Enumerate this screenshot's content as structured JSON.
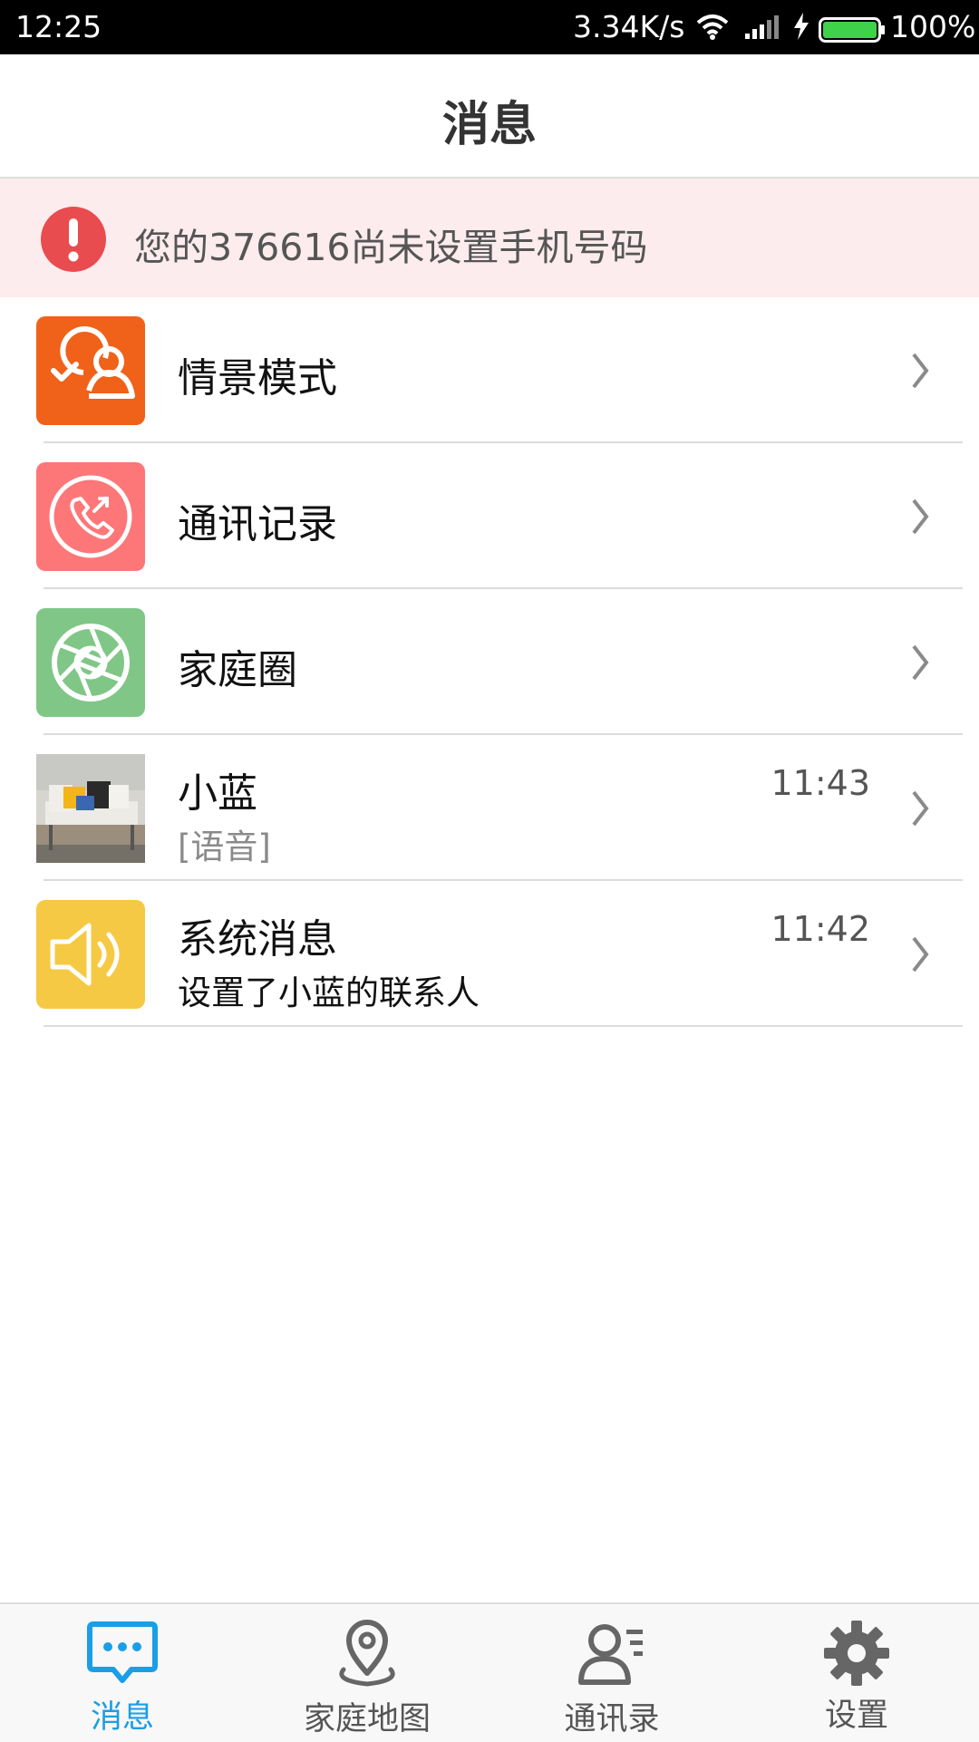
{
  "status_bar": {
    "time": "12:25",
    "speed": "3.34K/s",
    "battery": "100%",
    "battery_level": 1.0
  },
  "header": {
    "title": "消息"
  },
  "alert": {
    "text": "您的376616尚未设置手机号码",
    "icon": "exclamation-icon",
    "color": "#e84c4f"
  },
  "list": {
    "items": [
      {
        "title": "情景模式",
        "icon": "scene-mode-icon",
        "icon_color": "#f0611a"
      },
      {
        "title": "通讯记录",
        "icon": "phone-icon",
        "icon_color": "#fd7779"
      },
      {
        "title": "家庭圈",
        "icon": "aperture-icon",
        "icon_color": "#80c787"
      },
      {
        "title": "小蓝",
        "subtitle": "[语音]",
        "time": "11:43",
        "icon": "avatar-photo"
      },
      {
        "title": "系统消息",
        "subtitle": "设置了小蓝的联系人",
        "time": "11:42",
        "icon": "speaker-icon",
        "icon_color": "#f6c944"
      }
    ]
  },
  "tabbar": {
    "tabs": [
      {
        "label": "消息",
        "icon": "message-icon",
        "active": true
      },
      {
        "label": "家庭地图",
        "icon": "location-pin-icon",
        "active": false
      },
      {
        "label": "通讯录",
        "icon": "contacts-icon",
        "active": false
      },
      {
        "label": "设置",
        "icon": "gear-icon",
        "active": false
      }
    ],
    "active_color": "#1a9ee6",
    "inactive_color": "#666666"
  }
}
